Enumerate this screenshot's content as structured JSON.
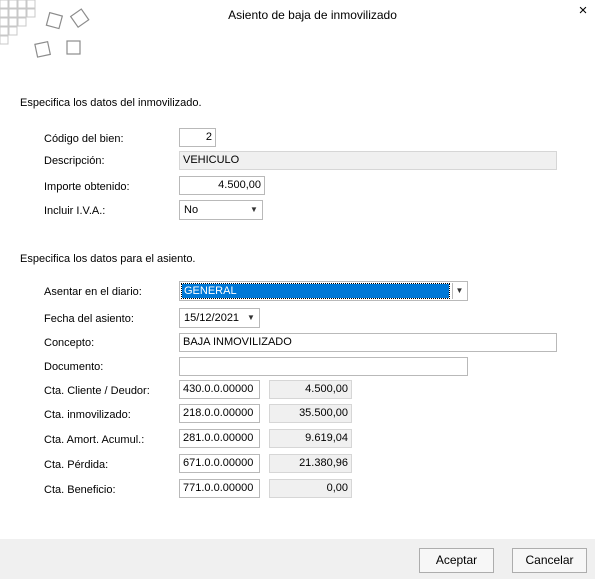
{
  "window": {
    "title": "Asiento de baja de inmovilizado"
  },
  "section1": {
    "heading": "Especifica  los datos del inmovilizado."
  },
  "fields1": {
    "codigo_label": "Código del bien:",
    "codigo_value": "2",
    "descripcion_label": "Descripción:",
    "descripcion_value": "VEHICULO",
    "importe_label": "Importe obtenido:",
    "importe_value": "4.500,00",
    "iva_label": "Incluir I.V.A.:",
    "iva_value": "No"
  },
  "section2": {
    "heading": "Especifica los datos para el asiento."
  },
  "fields2": {
    "diario_label": "Asentar en el diario:",
    "diario_value": "GENERAL",
    "fecha_label": "Fecha del asiento:",
    "fecha_value": "15/12/2021",
    "concepto_label": "Concepto:",
    "concepto_value": "BAJA INMOVILIZADO",
    "documento_label": "Documento:",
    "documento_value": ""
  },
  "accounts": [
    {
      "label": "Cta. Cliente / Deudor:",
      "account": "430.0.0.00000",
      "amount": "4.500,00"
    },
    {
      "label": "Cta. inmovilizado:",
      "account": "218.0.0.00000",
      "amount": "35.500,00"
    },
    {
      "label": "Cta. Amort. Acumul.:",
      "account": "281.0.0.00000",
      "amount": "9.619,04"
    },
    {
      "label": "Cta. Pérdida:",
      "account": "671.0.0.00000",
      "amount": "21.380,96"
    },
    {
      "label": "Cta. Beneficio:",
      "account": "771.0.0.00000",
      "amount": "0,00"
    }
  ],
  "buttons": {
    "accept": "Aceptar",
    "cancel": "Cancelar"
  },
  "icons": {
    "close": "×",
    "dropdown": "▼"
  }
}
